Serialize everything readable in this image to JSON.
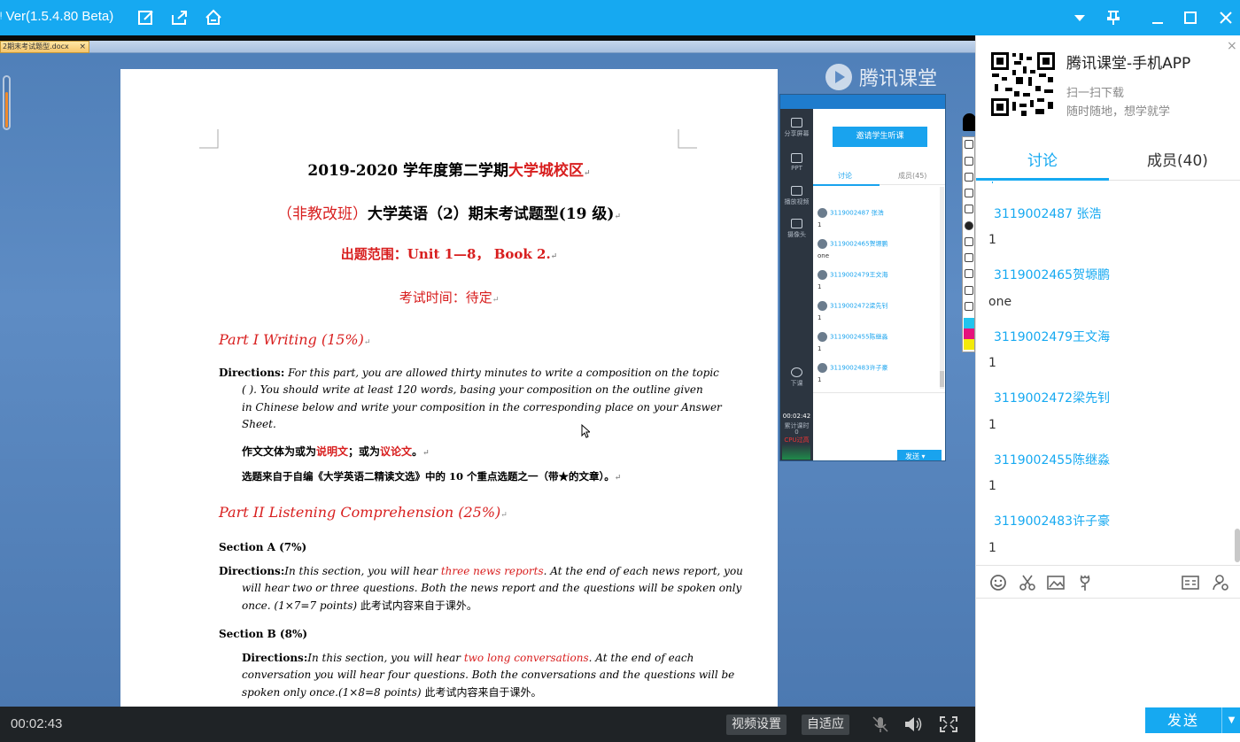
{
  "titlebar": {
    "title": "ᵎ Ver(1.5.4.80 Beta)",
    "icons": [
      "edit-icon",
      "share-icon",
      "home-icon"
    ],
    "window_controls": [
      "dropdown-icon",
      "pin-icon",
      "minimize-icon",
      "maximize-icon",
      "close-icon"
    ]
  },
  "document": {
    "tab_name": "2期末考试题型.docx",
    "tab_close": "×",
    "brand": "腾讯课堂",
    "title_line1_black": "2019-2020 学年度第二学期",
    "title_line1_red": "大学城校区",
    "title_line2_red": "（非教改班）",
    "title_line2_black": "大学英语（2）期末考试题型(19 级)",
    "scope": "出题范围：Unit 1—8，  Book 2.",
    "time": "考试时间：待定",
    "part1_heading": "Part I Writing (15%)",
    "part1_directions_label": "Directions:",
    "part1_directions_lines": [
      "For this part, you are allowed thirty minutes to write a composition on the topic",
      "(        ). You should write at least 120 words, basing your composition on the outline given",
      "in Chinese below and write your composition in the corresponding place on your Answer",
      "Sheet."
    ],
    "genre_a": "作文文体为或为",
    "genre_b": "说明文",
    "genre_c": "；或为",
    "genre_d": "议论文",
    "genre_e": "。",
    "topic_source": "选题来自于自编《大学英语二精读文选》中的 10 个重点选题之一（带★的文章）。",
    "part2_heading": "Part II Listening Comprehension  (25%)",
    "sectionA": "Section A (7%)",
    "sectionA_label": "Directions:",
    "sectionA_a": "In this section, you will hear ",
    "sectionA_red": "three news reports",
    "sectionA_b": ". At the end of each news report, you",
    "sectionA_line2": "will hear two or three questions. Both the news report and the questions will be spoken only",
    "sectionA_line3": "once. (1×7=7 points)",
    "sectionA_line3_cn": "此考试内容来自于课外。",
    "sectionB": "Section B (8%)",
    "sectionB_label": "Directions:",
    "sectionB_a": "In this section, you will hear ",
    "sectionB_red": "two long conversations",
    "sectionB_b": ". At the end of each",
    "sectionB_line2": "conversation you will hear four questions. Both the conversations and the questions will be",
    "sectionB_line3": "spoken only once.(1×8=8 points)",
    "sectionB_line3_cn": "此考试内容来自于课外。"
  },
  "mini_window": {
    "side_items": [
      "分享屏幕",
      "PPT",
      "播放视频",
      "摄像头",
      "下课"
    ],
    "invite_button": "邀请学生听课",
    "tab_discuss": "讨论",
    "tab_members": "成员(45)",
    "messages": [
      {
        "name": "3119002487 张浩",
        "text": "1"
      },
      {
        "name": "3119002465贺塬鹏",
        "text": "one"
      },
      {
        "name": "3119002479王文海",
        "text": "1"
      },
      {
        "name": "3119002472梁先钊",
        "text": "1"
      },
      {
        "name": "3119002455陈继淼",
        "text": "1"
      },
      {
        "name": "3119002483许子豪",
        "text": "1"
      }
    ],
    "timer": "00:02:42",
    "stat_label": "累计课时",
    "stat_value": "0",
    "cpu_label": "CPU过高",
    "send": "发送"
  },
  "bottombar": {
    "time": "00:02:43",
    "video_settings": "视频设置",
    "adaptive": "自适应"
  },
  "right_panel": {
    "app_title": "腾讯课堂-手机APP",
    "scan_hint": "扫一扫下载",
    "slogan": "随时随地，想学就学",
    "close": "×",
    "tab_discuss": "讨论",
    "tab_members": "成员(40)",
    "messages": [
      {
        "name": "3119002487 张浩",
        "text": "1"
      },
      {
        "name": "3119002465贺塬鹏",
        "text": "one"
      },
      {
        "name": "3119002479王文海",
        "text": "1"
      },
      {
        "name": "3119002472梁先钊",
        "text": "1"
      },
      {
        "name": "3119002455陈继淼",
        "text": "1"
      },
      {
        "name": "3119002483许子豪",
        "text": "1"
      }
    ],
    "send_button": "发送",
    "send_dropdown": "▼"
  },
  "colors": {
    "accent": "#16a9f1",
    "doc_red": "#d81e1e",
    "bottom_bar": "#1f2326"
  }
}
